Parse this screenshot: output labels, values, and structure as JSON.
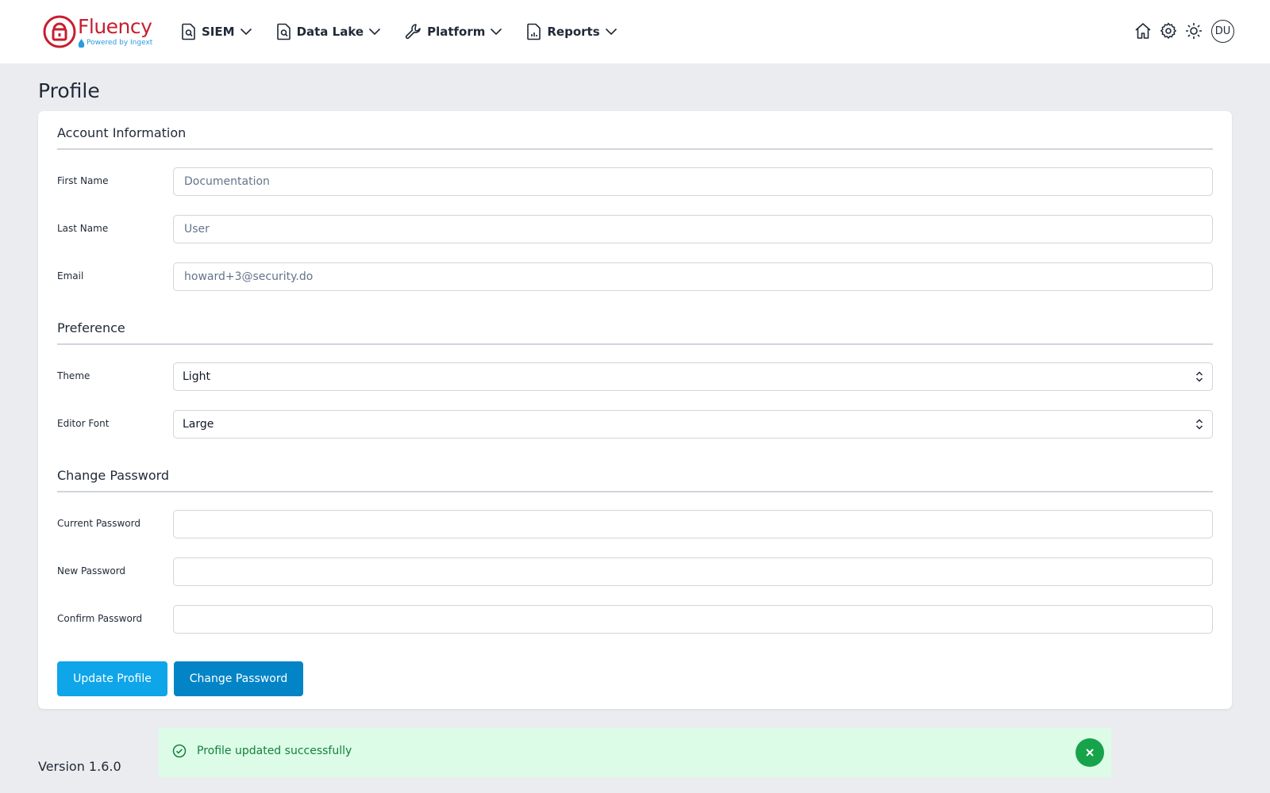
{
  "brand": {
    "name": "Fluency",
    "tagline": "Powered by Ingext",
    "color": "#c81e2f",
    "tagline_color": "#2b9ae0"
  },
  "nav": {
    "items": [
      {
        "label": "SIEM",
        "icon": "document-search-icon"
      },
      {
        "label": "Data Lake",
        "icon": "document-search-icon"
      },
      {
        "label": "Platform",
        "icon": "wrench-icon"
      },
      {
        "label": "Reports",
        "icon": "report-document-icon"
      }
    ],
    "right_icons": [
      "home-icon",
      "gear-icon",
      "sun-icon"
    ],
    "avatar_initials": "DU"
  },
  "page": {
    "title": "Profile"
  },
  "account": {
    "section_title": "Account Information",
    "first_name": {
      "label": "First Name",
      "placeholder": "Documentation"
    },
    "last_name": {
      "label": "Last Name",
      "placeholder": "User"
    },
    "email": {
      "label": "Email",
      "placeholder": "howard+3@security.do"
    }
  },
  "preference": {
    "section_title": "Preference",
    "theme": {
      "label": "Theme",
      "value": "Light"
    },
    "editor_font": {
      "label": "Editor Font",
      "value": "Large"
    }
  },
  "password": {
    "section_title": "Change Password",
    "current": {
      "label": "Current Password"
    },
    "new": {
      "label": "New Password"
    },
    "confirm": {
      "label": "Confirm Password"
    }
  },
  "buttons": {
    "update_profile": "Update Profile",
    "change_password": "Change Password"
  },
  "colors": {
    "update_button": "#0ea5e9",
    "change_button": "#0284c7",
    "toast_bg": "#dcfce7",
    "toast_text": "#15803d"
  },
  "footer": {
    "version": "Version 1.6.0"
  },
  "toast": {
    "message": "Profile updated successfully"
  }
}
